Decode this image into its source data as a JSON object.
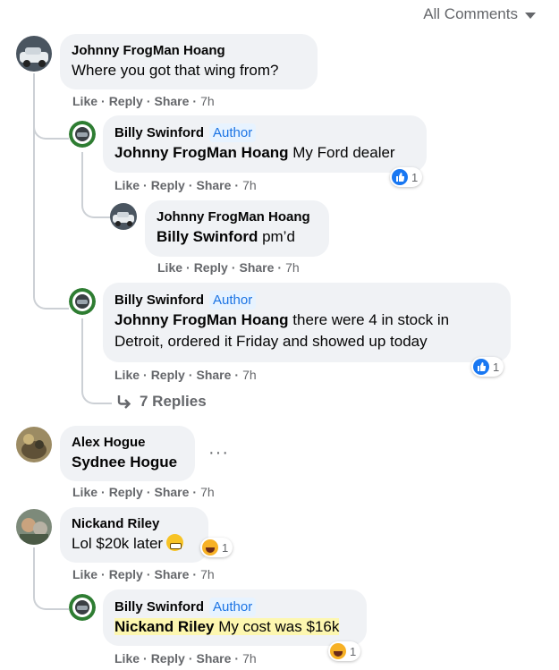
{
  "sort": {
    "label": "All Comments"
  },
  "actions": {
    "like": "Like",
    "reply": "Reply",
    "share": "Share",
    "sep": "·"
  },
  "comments": [
    {
      "author": "Johnny FrogMan Hoang",
      "text": "Where you got that wing from?",
      "time": "7h"
    },
    {
      "author": "Billy Swinford",
      "badge": "Author",
      "mention": "Johnny FrogMan Hoang",
      "text": " My Ford dealer",
      "time": "7h",
      "reaction_count": "1"
    },
    {
      "author": "Johnny FrogMan Hoang",
      "mention": "Billy Swinford",
      "text": " pm’d",
      "time": "7h"
    },
    {
      "author": "Billy Swinford",
      "badge": "Author",
      "mention": "Johnny FrogMan Hoang",
      "text_line1": " there were 4 in stock in",
      "text_line2": "Detroit, ordered it Friday and showed up today",
      "time": "7h",
      "reaction_count": "1"
    },
    {
      "author": "Alex Hogue",
      "mention": "Sydnee Hogue",
      "time": "7h"
    },
    {
      "author": "Nickand Riley",
      "text": "Lol $20k later",
      "time": "7h",
      "reaction_count": "1"
    },
    {
      "author": "Billy Swinford",
      "badge": "Author",
      "mention": "Nickand Riley",
      "text": " My cost was $16k",
      "time": "7h",
      "reaction_count": "1"
    }
  ],
  "replies_link": {
    "label": "7 Replies"
  },
  "colors": {
    "bubble": "#f0f2f5",
    "author_badge": "#1b74e4",
    "like": "#1877f2",
    "highlight": "#fdf7b0"
  }
}
